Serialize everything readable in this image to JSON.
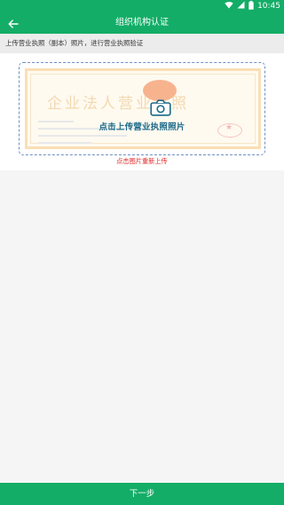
{
  "status_bar": {
    "time": "10:45",
    "icons": [
      "wifi-icon",
      "signal-icon",
      "battery-icon"
    ]
  },
  "app_bar": {
    "title": "组织机构认证",
    "back_icon": "arrow-back-icon"
  },
  "hint": {
    "text": "上传营业执照（副本）照片，进行营业执照验证"
  },
  "upload": {
    "sample_title": "企业法人营业执照",
    "label": "点击上传营业执照照片",
    "camera_icon": "camera-icon",
    "reupload_text": "点击图片重新上传"
  },
  "footer": {
    "next_label": "下一步"
  },
  "colors": {
    "primary": "#13ad67",
    "hint_bg": "#ececec",
    "error": "#e02424",
    "dashed_border": "#6e8fc4",
    "label": "#1c6a8a"
  }
}
